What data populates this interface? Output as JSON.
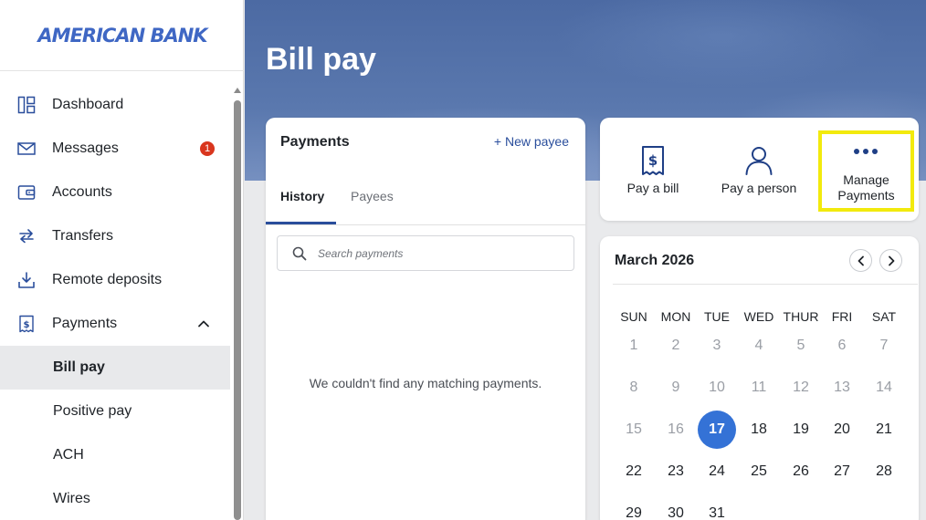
{
  "brand": {
    "logo_text": "AMERICAN BANK",
    "accent": "#3f67c4"
  },
  "sidebar": {
    "items": [
      {
        "label": "Dashboard",
        "icon": "dashboard-icon"
      },
      {
        "label": "Messages",
        "icon": "mail-icon",
        "badge": "1"
      },
      {
        "label": "Accounts",
        "icon": "wallet-icon"
      },
      {
        "label": "Transfers",
        "icon": "transfer-arrows-icon"
      },
      {
        "label": "Remote deposits",
        "icon": "download-tray-icon"
      },
      {
        "label": "Payments",
        "icon": "receipt-dollar-icon",
        "expanded": true
      },
      {
        "label": "Bill pay",
        "active": true
      },
      {
        "label": "Positive pay"
      },
      {
        "label": "ACH"
      },
      {
        "label": "Wires"
      }
    ]
  },
  "page": {
    "title": "Bill pay"
  },
  "payments": {
    "title": "Payments",
    "new_payee": "+ New payee",
    "tabs": [
      "History",
      "Payees"
    ],
    "active_tab": "History",
    "search_placeholder": "Search payments",
    "empty_message": "We couldn't find any matching payments."
  },
  "actions": [
    {
      "label": "Pay a bill",
      "icon": "receipt-dollar-icon"
    },
    {
      "label": "Pay a person",
      "icon": "person-icon"
    },
    {
      "label": "Manage\nPayments",
      "icon": "more-dots-icon",
      "highlighted": true
    }
  ],
  "calendar": {
    "month": "March 2026",
    "weekdays": [
      "SUN",
      "MON",
      "TUE",
      "WED",
      "THUR",
      "FRI",
      "SAT"
    ],
    "weeks": [
      [
        "1",
        "2",
        "3",
        "4",
        "5",
        "6",
        "7"
      ],
      [
        "8",
        "9",
        "10",
        "11",
        "12",
        "13",
        "14"
      ],
      [
        "15",
        "16",
        "17",
        "18",
        "19",
        "20",
        "21"
      ],
      [
        "22",
        "23",
        "24",
        "25",
        "26",
        "27",
        "28"
      ],
      [
        "29",
        "30",
        "31",
        "",
        "",
        "",
        ""
      ]
    ],
    "selected": "17",
    "first_enabled": "17",
    "selected_color": "#3472d6"
  }
}
